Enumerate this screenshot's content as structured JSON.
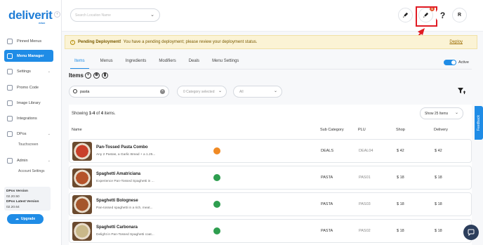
{
  "brand": {
    "logo_text": "deliverit",
    "logo_sub": "edux"
  },
  "sidebar": {
    "items": [
      {
        "label": "Pinned Menus",
        "icon": "pin-icon"
      },
      {
        "label": "Menu Manager",
        "icon": "menu-book-icon",
        "active": true
      },
      {
        "label": "Settings",
        "icon": "gear-icon",
        "expandable": true
      },
      {
        "label": "Promo Code",
        "icon": "ticket-icon"
      },
      {
        "label": "Image Library",
        "icon": "image-icon"
      },
      {
        "label": "Integrations",
        "icon": "plug-icon"
      },
      {
        "label": "DPos",
        "icon": "pos-icon",
        "expandable": true
      },
      {
        "label": "Admin",
        "icon": "lock-icon",
        "expandable": true
      }
    ],
    "subitems": {
      "dpos": "Touchscreen",
      "admin": "Account Settings"
    },
    "version": {
      "dpos_label": "DPos Version",
      "dpos_value": "02.20.50",
      "latest_label": "DPos Latest Version",
      "latest_value": "02.20.64"
    },
    "upgrade_label": "Upgrade"
  },
  "topbar": {
    "location_placeholder": "Search Location Name",
    "deploy_badge": "1",
    "help_label": "?",
    "avatar_initial": "R"
  },
  "banner": {
    "title": "Pending Deployment!",
    "message": "You have a pending deployment; please review your deployment status.",
    "link": "Deploy"
  },
  "tabs": [
    "Items",
    "Menus",
    "Ingredients",
    "Modifiers",
    "Deals",
    "Menu Settings"
  ],
  "active_toggle_label": "Active",
  "items_section": {
    "title": "Items",
    "search_value": "pasta",
    "category_placeholder": "0 Category selected",
    "type_value": "All",
    "showing_prefix": "Showing ",
    "showing_range": "1-4",
    "showing_mid": " of ",
    "showing_total": "4",
    "showing_suffix": " items.",
    "page_size": "Show 25 Items"
  },
  "table": {
    "headers": {
      "name": "Name",
      "sub_category": "Sub Category",
      "plu": "PLU",
      "shop": "Shop",
      "delivery": "Delivery"
    },
    "rows": [
      {
        "name": "Pan-Tossed Pasta Combo",
        "desc": "Any 2 Pastas, a Garlic Bread + a 1.25...",
        "tag_color": "#f08a24",
        "sub_category": "DEALS",
        "plu": "DEAL04",
        "shop": "$ 42",
        "delivery": "$ 42",
        "thumb": "#c9402a"
      },
      {
        "name": "Spaghetti Amatriciana",
        "desc": "Experience Pan-Tossed Spaghetti in ...",
        "tag_color": "#2e9e4f",
        "sub_category": "PASTA",
        "plu": "PAS01",
        "shop": "$ 18",
        "delivery": "$ 18",
        "thumb": "#b5532a"
      },
      {
        "name": "Spaghetti Bolognese",
        "desc": "Pan-tossed spaghetti in a rich, meat...",
        "tag_color": "#2e9e4f",
        "sub_category": "PASTA",
        "plu": "PAS03",
        "shop": "$ 18",
        "delivery": "$ 18",
        "thumb": "#a5562c"
      },
      {
        "name": "Spaghetti Carbonara",
        "desc": "Delight in Pan-Tossed Spaghetti coat...",
        "tag_color": "#2e9e4f",
        "sub_category": "PASTA",
        "plu": "PAS02",
        "shop": "$ 18",
        "delivery": "$ 18",
        "thumb": "#c9b889"
      }
    ]
  },
  "feedback_label": "Feedback",
  "colors": {
    "primary": "#1f8ce6",
    "banner_bg": "#fbf3d5",
    "highlight": "#e01b24"
  }
}
